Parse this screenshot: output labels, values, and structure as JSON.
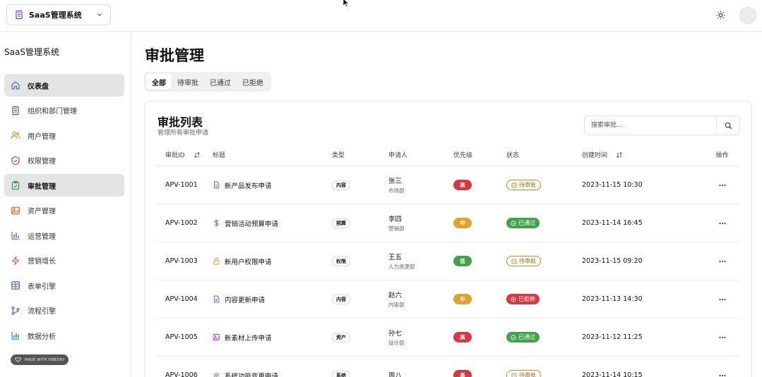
{
  "topbar": {
    "org_name": "SaaS管理系统"
  },
  "sidebar": {
    "title": "SaaS管理系统",
    "items": [
      {
        "label": "仪表盘",
        "icon": "home-icon"
      },
      {
        "label": "组织和部门管理",
        "icon": "building-icon"
      },
      {
        "label": "用户管理",
        "icon": "users-icon"
      },
      {
        "label": "权限管理",
        "icon": "shield-icon"
      },
      {
        "label": "审批管理",
        "icon": "clipboard-check-icon"
      },
      {
        "label": "资产管理",
        "icon": "image-icon"
      },
      {
        "label": "运营管理",
        "icon": "bar-chart-icon"
      },
      {
        "label": "营销增长",
        "icon": "zap-icon"
      },
      {
        "label": "表单引擎",
        "icon": "table-icon"
      },
      {
        "label": "流程引擎",
        "icon": "workflow-icon"
      },
      {
        "label": "数据分析",
        "icon": "analytics-icon"
      }
    ],
    "made_with": "MADE WITH VIBEDEV"
  },
  "main": {
    "page_title": "审批管理",
    "tabs": [
      {
        "label": "全部"
      },
      {
        "label": "待审批"
      },
      {
        "label": "已通过"
      },
      {
        "label": "已拒绝"
      }
    ],
    "card": {
      "title": "审批列表",
      "subtitle": "管理所有审批申请",
      "search_placeholder": "搜索审批..."
    },
    "table": {
      "headers": {
        "id": "审批ID",
        "title": "标题",
        "type": "类型",
        "applicant": "申请人",
        "priority": "优先级",
        "status": "状态",
        "created": "创建时间",
        "ops": "操作"
      },
      "rows": [
        {
          "id": "APV-1001",
          "title": "新产品发布申请",
          "title_icon": "file-icon",
          "type": "内容",
          "name": "张三",
          "dept": "市场部",
          "priority": "高",
          "status": "待审批",
          "time": "2023-11-15 10:30"
        },
        {
          "id": "APV-1002",
          "title": "营销活动预算申请",
          "title_icon": "dollar-icon",
          "type": "预算",
          "name": "李四",
          "dept": "营销部",
          "priority": "中",
          "status": "已通过",
          "time": "2023-11-14 16:45"
        },
        {
          "id": "APV-1003",
          "title": "新用户权限申请",
          "title_icon": "lock-icon",
          "type": "权限",
          "name": "王五",
          "dept": "人力资源部",
          "priority": "低",
          "status": "待审批",
          "time": "2023-11-15 09:20"
        },
        {
          "id": "APV-1004",
          "title": "内容更新申请",
          "title_icon": "file-icon",
          "type": "内容",
          "name": "赵六",
          "dept": "内容部",
          "priority": "中",
          "status": "已拒绝",
          "time": "2023-11-13 14:30"
        },
        {
          "id": "APV-1005",
          "title": "新素材上传申请",
          "title_icon": "image-icon",
          "type": "资产",
          "name": "孙七",
          "dept": "设计部",
          "priority": "高",
          "status": "已通过",
          "time": "2023-11-12 11:25"
        },
        {
          "id": "APV-1006",
          "title": "系统功能变更申请",
          "title_icon": "gear-icon",
          "type": "系统",
          "name": "周八",
          "dept": "",
          "priority": "高",
          "status": "待审批",
          "time": "2023-11-14 10:15"
        }
      ]
    }
  },
  "colors": {
    "priority_high": "#d9363e",
    "priority_mid": "#e2a12b",
    "priority_low": "#3fa34d",
    "status_pending": "#d48806",
    "status_approved": "#3fa34d",
    "status_rejected": "#d9363e"
  }
}
